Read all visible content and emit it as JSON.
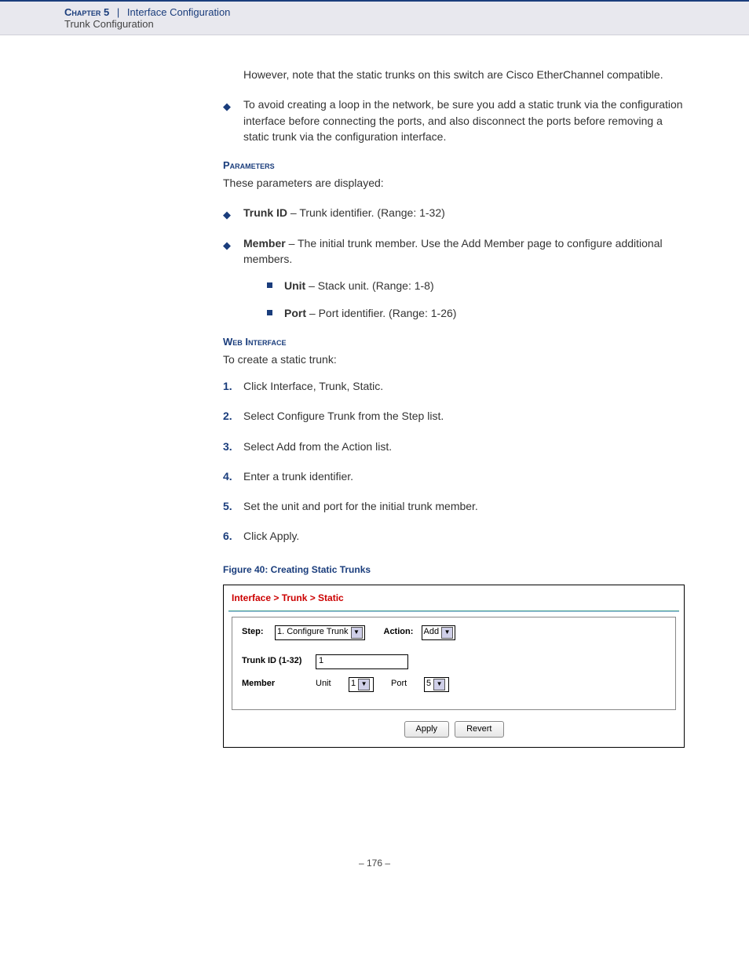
{
  "header": {
    "chapter": "Chapter 5",
    "sep": "|",
    "title": "Interface Configuration",
    "subtitle": "Trunk Configuration"
  },
  "para_lead": "However, note that the static trunks on this switch are Cisco EtherChannel compatible.",
  "bullet_loop": "To avoid creating a loop in the network, be sure you add a static trunk via the configuration interface before connecting the ports, and also disconnect the ports before removing a static trunk via the configuration interface.",
  "params": {
    "heading": "Parameters",
    "intro": "These parameters are displayed:",
    "trunk_id_label": "Trunk ID",
    "trunk_id_text": " – Trunk identifier. (Range: 1-32)",
    "member_label": "Member",
    "member_text": " – The initial trunk member. Use the Add Member page to configure additional members.",
    "unit_label": "Unit",
    "unit_text": " – Stack unit. (Range: 1-8)",
    "port_label": "Port",
    "port_text": " – Port identifier. (Range: 1-26)"
  },
  "webif": {
    "heading": "Web Interface",
    "intro": "To create a static trunk:",
    "steps": [
      "Click Interface, Trunk, Static.",
      "Select Configure Trunk from the Step list.",
      "Select Add from the Action list.",
      "Enter a trunk identifier.",
      "Set the unit and port for the initial trunk member.",
      "Click Apply."
    ]
  },
  "figure_caption": "Figure 40:  Creating Static Trunks",
  "ui": {
    "breadcrumb": "Interface > Trunk > Static",
    "step_label": "Step:",
    "step_value": "1. Configure Trunk",
    "action_label": "Action:",
    "action_value": "Add",
    "trunk_id_label": "Trunk ID (1-32)",
    "trunk_id_value": "1",
    "member_label": "Member",
    "unit_label": "Unit",
    "unit_value": "1",
    "port_label": "Port",
    "port_value": "5",
    "apply": "Apply",
    "revert": "Revert"
  },
  "pagenum": "–  176  –"
}
